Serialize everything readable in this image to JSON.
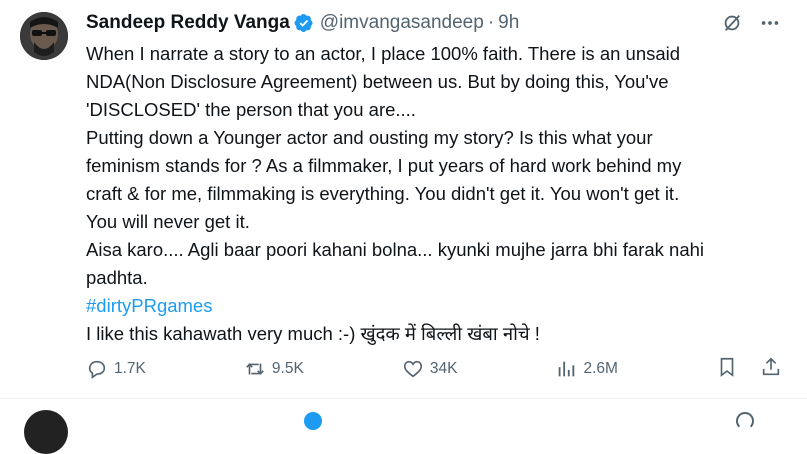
{
  "tweet": {
    "author_name": "Sandeep Reddy Vanga",
    "handle": "@imvangasandeep",
    "separator": "·",
    "time": "9h",
    "lines": [
      "When I narrate a story to an actor, I place 100% faith. There is an unsaid",
      "NDA(Non Disclosure Agreement) between us. But by doing this, You've",
      "'DISCLOSED' the person that you are....",
      "Putting down a Younger actor and ousting my story?  Is this what your",
      "feminism stands for ? As a filmmaker, I put years of hard work behind my",
      "craft & for me, filmmaking is everything. You didn't get it. You won't get it.",
      "You will never get it.",
      "Aisa karo.... Agli baar poori kahani bolna... kyunki mujhe jarra bhi farak nahi",
      "padhta."
    ],
    "hashtag": "#dirtyPRgames",
    "last_line": "I like this kahawath very much :-) खुंदक में बिल्ली खंबा नोचे !",
    "stats": {
      "replies": "1.7K",
      "reposts": "9.5K",
      "likes": "34K",
      "views": "2.6M"
    }
  },
  "colors": {
    "text": "#0f1419",
    "secondary": "#536471",
    "accent": "#1d9bf0"
  },
  "icons": [
    "verified-badge-icon",
    "grok-icon",
    "more-icon",
    "reply-icon",
    "repost-icon",
    "like-icon",
    "views-icon",
    "bookmark-icon",
    "share-icon"
  ]
}
